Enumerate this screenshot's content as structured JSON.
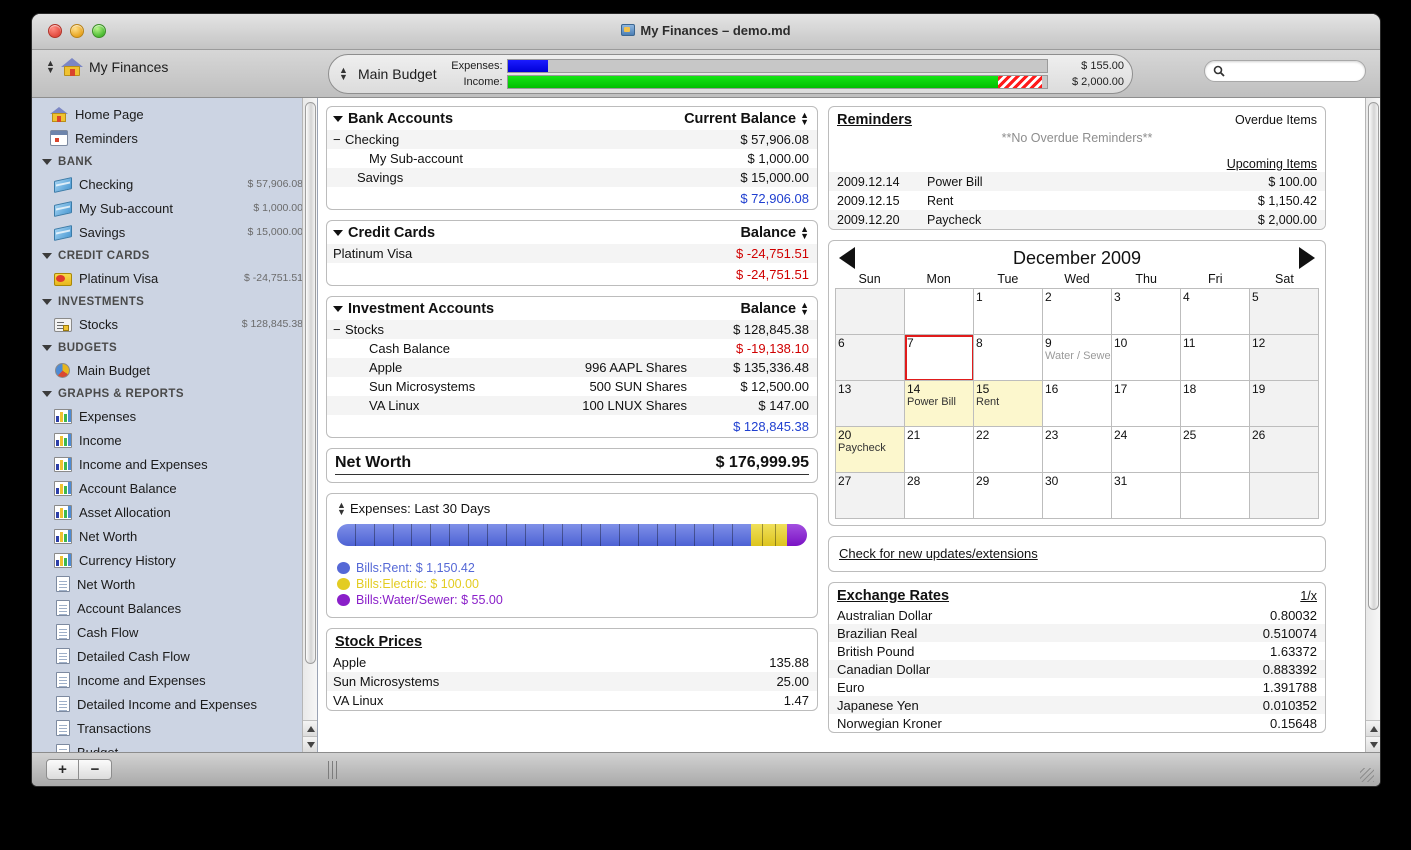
{
  "window": {
    "title": "My Finances – demo.md",
    "doc_name": "My Finances"
  },
  "toolbar": {
    "budget_name": "Main Budget",
    "expenses_label": "Expenses:",
    "income_label": "Income:",
    "expenses_value": "$ 155.00",
    "income_value": "$ 2,000.00",
    "expenses_pct": 7.5,
    "income_pct": 91,
    "income_hatch_pct": 8,
    "search_placeholder": "",
    "search_value": ""
  },
  "sidebar": {
    "top_items": [
      {
        "label": "Home Page",
        "icon": "house-icon"
      },
      {
        "label": "Reminders",
        "icon": "calendar-icon"
      }
    ],
    "groups": [
      {
        "title": "BANK",
        "items": [
          {
            "label": "Checking",
            "amount": "$ 57,906.08",
            "icon": "bank-icon"
          },
          {
            "label": "My Sub-account",
            "amount": "$ 1,000.00",
            "icon": "bank-icon"
          },
          {
            "label": "Savings",
            "amount": "$ 15,000.00",
            "icon": "bank-icon"
          }
        ]
      },
      {
        "title": "CREDIT CARDS",
        "items": [
          {
            "label": "Platinum Visa",
            "amount": "$ -24,751.51",
            "icon": "credit-card-icon"
          }
        ]
      },
      {
        "title": "INVESTMENTS",
        "items": [
          {
            "label": "Stocks",
            "amount": "$ 128,845.38",
            "icon": "stock-icon"
          }
        ]
      },
      {
        "title": "BUDGETS",
        "items": [
          {
            "label": "Main Budget",
            "amount": "",
            "icon": "pie-chart-icon"
          }
        ]
      },
      {
        "title": "GRAPHS & REPORTS",
        "items": [
          {
            "label": "Expenses",
            "amount": "",
            "icon": "graph-icon"
          },
          {
            "label": "Income",
            "amount": "",
            "icon": "graph-icon"
          },
          {
            "label": "Income and Expenses",
            "amount": "",
            "icon": "graph-icon"
          },
          {
            "label": "Account Balance",
            "amount": "",
            "icon": "graph-icon"
          },
          {
            "label": "Asset Allocation",
            "amount": "",
            "icon": "graph-icon"
          },
          {
            "label": "Net Worth",
            "amount": "",
            "icon": "graph-icon"
          },
          {
            "label": "Currency History",
            "amount": "",
            "icon": "graph-icon"
          },
          {
            "label": "Net Worth",
            "amount": "",
            "icon": "document-icon"
          },
          {
            "label": "Account Balances",
            "amount": "",
            "icon": "document-icon"
          },
          {
            "label": "Cash Flow",
            "amount": "",
            "icon": "document-icon"
          },
          {
            "label": "Detailed Cash Flow",
            "amount": "",
            "icon": "document-icon"
          },
          {
            "label": "Income and Expenses",
            "amount": "",
            "icon": "document-icon"
          },
          {
            "label": "Detailed Income and Expenses",
            "amount": "",
            "icon": "document-icon"
          },
          {
            "label": "Transactions",
            "amount": "",
            "icon": "document-icon"
          },
          {
            "label": "Budget",
            "amount": "",
            "icon": "document-icon"
          }
        ]
      }
    ],
    "add_label": "+",
    "remove_label": "−"
  },
  "bank_accounts": {
    "title": "Bank Accounts",
    "column": "Current Balance",
    "rows": [
      {
        "name": "Checking",
        "value": "$ 57,906.08",
        "indent": 0,
        "expander": "−"
      },
      {
        "name": "My Sub-account",
        "value": "$ 1,000.00",
        "indent": 2,
        "expander": ""
      },
      {
        "name": "Savings",
        "value": "$ 15,000.00",
        "indent": 1,
        "expander": ""
      }
    ],
    "total": "$ 72,906.08"
  },
  "credit_cards": {
    "title": "Credit Cards",
    "column": "Balance",
    "rows": [
      {
        "name": "Platinum Visa",
        "value": "$ -24,751.51",
        "negative": true
      }
    ],
    "total": "$ -24,751.51"
  },
  "investment_accounts": {
    "title": "Investment Accounts",
    "column": "Balance",
    "rows": [
      {
        "name": "Stocks",
        "shares": "",
        "value": "$ 128,845.38",
        "indent": 0,
        "expander": "−",
        "negative": false
      },
      {
        "name": "Cash Balance",
        "shares": "",
        "value": "$ -19,138.10",
        "indent": 2,
        "expander": "",
        "negative": true
      },
      {
        "name": "Apple",
        "shares": "996 AAPL Shares",
        "value": "$ 135,336.48",
        "indent": 2,
        "expander": "",
        "negative": false
      },
      {
        "name": "Sun Microsystems",
        "shares": "500 SUN Shares",
        "value": "$ 12,500.00",
        "indent": 2,
        "expander": "",
        "negative": false
      },
      {
        "name": "VA Linux",
        "shares": "100 LNUX Shares",
        "value": "$ 147.00",
        "indent": 2,
        "expander": "",
        "negative": false
      }
    ],
    "total": "$ 128,845.38"
  },
  "net_worth": {
    "label": "Net Worth",
    "value": "$ 176,999.95"
  },
  "chart_data": {
    "type": "bar",
    "title": "Expenses: Last 30 Days",
    "categories": [
      "Bills:Rent",
      "Bills:Electric",
      "Bills:Water/Sewer"
    ],
    "values": [
      1150.42,
      100.0,
      55.0
    ],
    "value_labels": [
      "$ 1,150.42",
      "$ 100.00",
      "$ 55.00"
    ],
    "colors": [
      "#5568d6",
      "#e3cc22",
      "#8a1fc9"
    ],
    "percents": [
      88.1,
      7.7,
      4.2
    ],
    "legend": [
      {
        "label": "Bills:Rent: $ 1,150.42",
        "color": "#5568d6"
      },
      {
        "label": "Bills:Electric: $ 100.00",
        "color": "#e3cc22"
      },
      {
        "label": "Bills:Water/Sewer: $ 55.00",
        "color": "#8a1fc9"
      }
    ],
    "orientation": "horizontal-stacked",
    "xlabel": "",
    "ylabel": "",
    "grid": false,
    "legend_position": "below"
  },
  "stock_prices": {
    "title": "Stock Prices",
    "rows": [
      {
        "name": "Apple",
        "price": "135.88"
      },
      {
        "name": "Sun Microsystems",
        "price": "25.00"
      },
      {
        "name": "VA Linux",
        "price": "1.47"
      }
    ]
  },
  "reminders": {
    "title": "Reminders",
    "overdue_header": "Overdue Items",
    "no_overdue": "**No Overdue Reminders**",
    "upcoming_header": "Upcoming Items",
    "upcoming": [
      {
        "date": "2009.12.14",
        "desc": "Power Bill",
        "amount": "$ 100.00"
      },
      {
        "date": "2009.12.15",
        "desc": "Rent",
        "amount": "$ 1,150.42"
      },
      {
        "date": "2009.12.20",
        "desc": "Paycheck",
        "amount": "$ 2,000.00"
      }
    ]
  },
  "calendar": {
    "month_title": "December 2009",
    "prev_label": "◀",
    "next_label": "▶",
    "dow": [
      "Sun",
      "Mon",
      "Tue",
      "Wed",
      "Thu",
      "Fri",
      "Sat"
    ],
    "weeks": [
      [
        {
          "day": "",
          "weekend": true
        },
        {
          "day": ""
        },
        {
          "day": "1"
        },
        {
          "day": "2"
        },
        {
          "day": "3"
        },
        {
          "day": "4"
        },
        {
          "day": "5",
          "weekend": true
        }
      ],
      [
        {
          "day": "6",
          "weekend": true
        },
        {
          "day": "7",
          "today": true
        },
        {
          "day": "8"
        },
        {
          "day": "9",
          "event": "Water / Sewe",
          "event_grey": true
        },
        {
          "day": "10"
        },
        {
          "day": "11"
        },
        {
          "day": "12",
          "weekend": true
        }
      ],
      [
        {
          "day": "13",
          "weekend": true
        },
        {
          "day": "14",
          "event": "Power Bill",
          "highlight": true
        },
        {
          "day": "15",
          "event": "Rent",
          "highlight": true
        },
        {
          "day": "16"
        },
        {
          "day": "17"
        },
        {
          "day": "18"
        },
        {
          "day": "19",
          "weekend": true
        }
      ],
      [
        {
          "day": "20",
          "event": "Paycheck",
          "highlight": true,
          "weekend": true
        },
        {
          "day": "21"
        },
        {
          "day": "22"
        },
        {
          "day": "23"
        },
        {
          "day": "24"
        },
        {
          "day": "25"
        },
        {
          "day": "26",
          "weekend": true
        }
      ],
      [
        {
          "day": "27",
          "weekend": true
        },
        {
          "day": "28"
        },
        {
          "day": "29"
        },
        {
          "day": "30"
        },
        {
          "day": "31"
        },
        {
          "day": ""
        },
        {
          "day": "",
          "weekend": true
        }
      ]
    ]
  },
  "updates": {
    "link": "Check for new updates/extensions"
  },
  "exchange_rates": {
    "title": "Exchange Rates",
    "column": "1/x",
    "rows": [
      {
        "currency": "Australian Dollar",
        "rate": "0.80032"
      },
      {
        "currency": "Brazilian Real",
        "rate": "0.510074"
      },
      {
        "currency": "British Pound",
        "rate": "1.63372"
      },
      {
        "currency": "Canadian Dollar",
        "rate": "0.883392"
      },
      {
        "currency": "Euro",
        "rate": "1.391788"
      },
      {
        "currency": "Japanese Yen",
        "rate": "0.010352"
      },
      {
        "currency": "Norwegian Kroner",
        "rate": "0.15648"
      }
    ]
  }
}
